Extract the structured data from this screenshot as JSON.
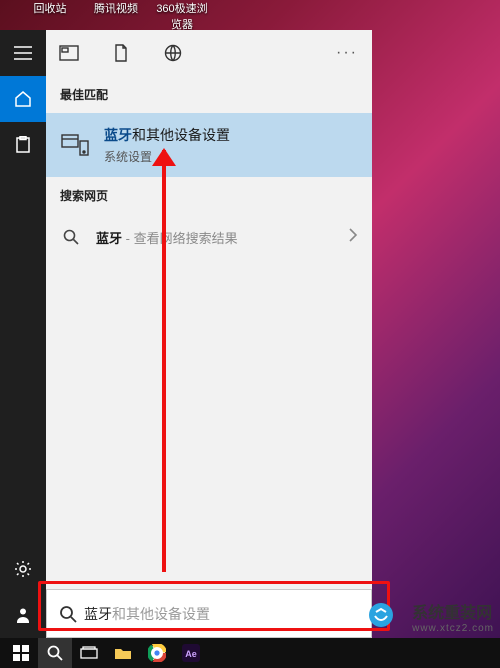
{
  "desktop": {
    "icons": [
      "回收站",
      "腾讯视频",
      "360极速浏览器"
    ]
  },
  "rail": {
    "menu": "menu",
    "home": "home",
    "clip": "clip",
    "settings": "settings",
    "user": "user"
  },
  "panel": {
    "tabs": {
      "more": "···"
    },
    "best_match_title": "最佳匹配",
    "hit": {
      "keyword": "蓝牙",
      "rest": "和其他设备设置",
      "subtitle": "系统设置"
    },
    "web_title": "搜索网页",
    "web": {
      "keyword": "蓝牙",
      "suffix": " - 查看网络搜索结果"
    }
  },
  "searchbox": {
    "typed": "蓝牙",
    "ghost": "和其他设备设置"
  },
  "watermark": {
    "title": "系统重装网",
    "sub": "www.xtcz2.com"
  }
}
